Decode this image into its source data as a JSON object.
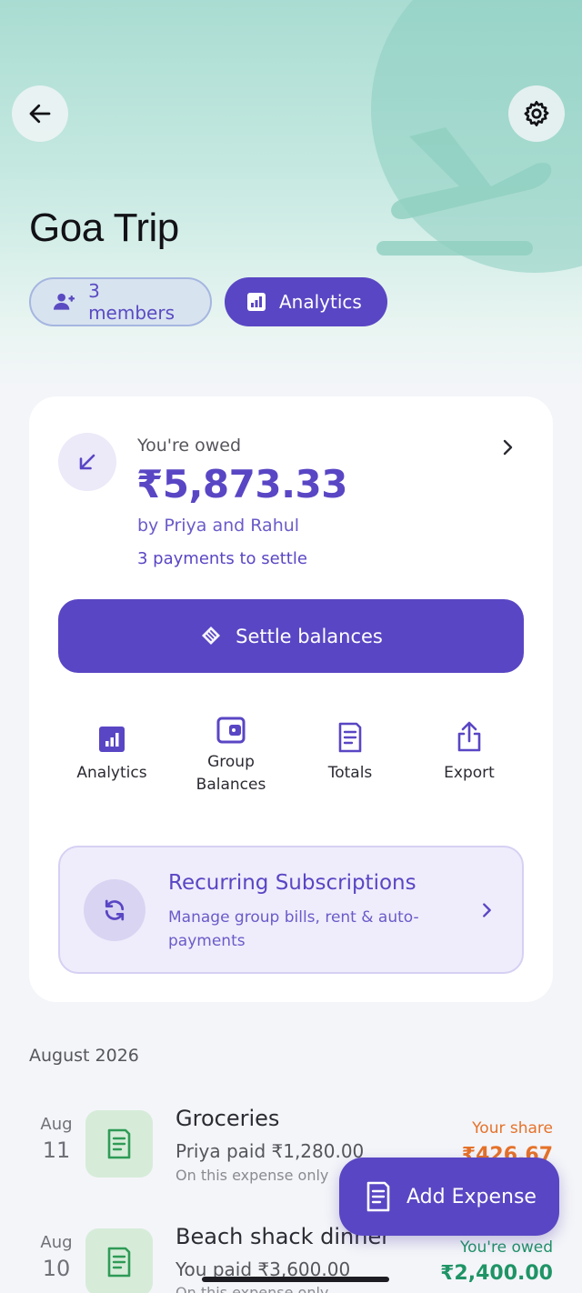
{
  "header": {
    "title": "Goa Trip",
    "members_chip": "3 members",
    "analytics_chip": "Analytics"
  },
  "summary": {
    "owed_label": "You're owed",
    "owed_amount": "₹5,873.33",
    "owed_by": "by Priya and Rahul",
    "payments_note": "3 payments to settle",
    "settle_button": "Settle balances"
  },
  "actions": [
    {
      "label": "Analytics",
      "icon": "bar-chart-icon"
    },
    {
      "label": "Group Balances",
      "icon": "wallet-icon"
    },
    {
      "label": "Totals",
      "icon": "receipt-icon"
    },
    {
      "label": "Export",
      "icon": "share-icon"
    }
  ],
  "recurring": {
    "title": "Recurring Subscriptions",
    "subtitle": "Manage group bills, rent & auto-payments"
  },
  "expenses": {
    "month": "August 2026",
    "items": [
      {
        "month": "Aug",
        "day": "11",
        "title": "Groceries",
        "paid": "Priya paid ₹1,280.00",
        "note": "On this expense only",
        "right_label": "Your share",
        "right_amount": "₹426.67",
        "right_color": "#e5722a"
      },
      {
        "month": "Aug",
        "day": "10",
        "title": "Beach shack dinner",
        "paid": "You paid ₹3,600.00",
        "note": "On this expense only",
        "right_label": "You're owed",
        "right_amount": "₹2,400.00",
        "right_color": "#1f9466"
      }
    ]
  },
  "fab": {
    "label": "Add Expense"
  },
  "colors": {
    "accent": "#5946c4",
    "owed_green": "#1f9466",
    "share_orange": "#e5722a",
    "hero_teal": "#a9dcd2"
  }
}
